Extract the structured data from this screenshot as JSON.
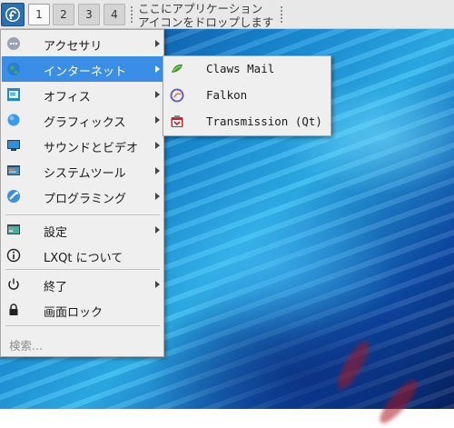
{
  "panel": {
    "desktops": [
      "1",
      "2",
      "3",
      "4"
    ],
    "active_desktop": "1",
    "drop_zone_line1": "ここにアプリケーション",
    "drop_zone_line2": "アイコンをドロップします"
  },
  "main_menu": {
    "items": [
      {
        "label": "アクセサリ",
        "icon": "accessories-icon",
        "submenu": true
      },
      {
        "label": "インターネット",
        "icon": "internet-globe-icon",
        "submenu": true,
        "highlighted": true
      },
      {
        "label": "オフィス",
        "icon": "office-icon",
        "submenu": true
      },
      {
        "label": "グラフィックス",
        "icon": "graphics-icon",
        "submenu": true
      },
      {
        "label": "サウンドとビデオ",
        "icon": "multimedia-icon",
        "submenu": true
      },
      {
        "label": "システムツール",
        "icon": "system-tools-icon",
        "submenu": true
      },
      {
        "label": "プログラミング",
        "icon": "programming-icon",
        "submenu": true
      },
      {
        "label": "設定",
        "icon": "settings-icon",
        "submenu": true
      },
      {
        "label": "LXQt について",
        "icon": "info-icon",
        "submenu": false
      },
      {
        "label": "終了",
        "icon": "power-icon",
        "submenu": true
      },
      {
        "label": "画面ロック",
        "icon": "lock-icon",
        "submenu": false
      }
    ],
    "search_placeholder": "検索..."
  },
  "internet_submenu": {
    "items": [
      {
        "label": "Claws Mail",
        "icon": "claws-mail-icon"
      },
      {
        "label": "Falkon",
        "icon": "falkon-icon"
      },
      {
        "label": "Transmission (Qt)",
        "icon": "transmission-icon"
      }
    ]
  },
  "colors": {
    "highlight": "#3a8ee6",
    "panel": "#e8e8e8",
    "menu_bg": "#efefef"
  }
}
